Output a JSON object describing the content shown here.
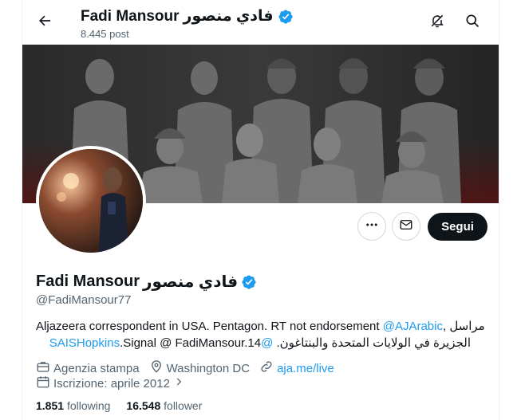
{
  "header": {
    "title_en": "Fadi Mansour",
    "title_ar": "فادي منصور",
    "post_count": "8.445 post"
  },
  "profile": {
    "name_en": "Fadi Mansour",
    "name_ar": "فادي منصور",
    "handle": "@FadiMansour77",
    "bio": {
      "line1_text": "Aljazeera correspondent in USA. Pentagon. RT not endorsement",
      "line1_mention": "@AJArabic",
      "line1_tail": ", مراسل",
      "line2_head": "الجزيرة في الولايات المتحدة والبنتاغون.",
      "line2_mention": "@SAISHopkins",
      "line2_tail": ".Signal @ FadiMansour.14"
    },
    "category": "Agenzia stampa",
    "location": "Washington DC",
    "website": "aja.me/live",
    "joined": "Iscrizione: aprile 2012",
    "following_count": "1.851",
    "following_label": "following",
    "followers_count": "16.548",
    "followers_label": "follower"
  },
  "actions": {
    "follow_label": "Segui"
  },
  "icons": {
    "back": "arrow-left-icon",
    "no_notify": "bell-slash-icon",
    "search": "search-icon",
    "more": "more-dots-icon",
    "message": "envelope-icon",
    "verified": "verified-badge-icon",
    "category": "briefcase-icon",
    "location": "location-pin-icon",
    "website": "link-icon",
    "calendar": "calendar-icon"
  },
  "colors": {
    "accent": "#1d9bf0",
    "text": "#0f1419",
    "muted": "#536471",
    "follow_bg": "#0f1419"
  }
}
